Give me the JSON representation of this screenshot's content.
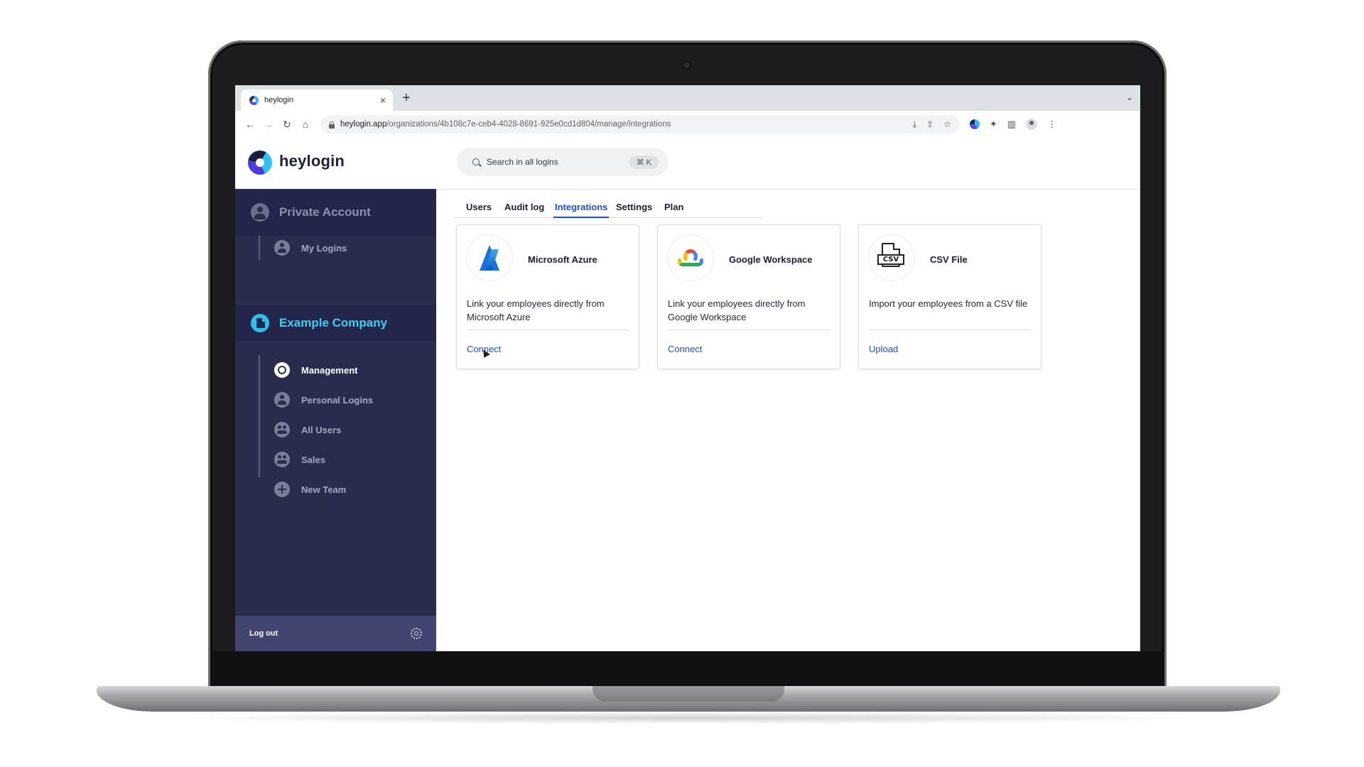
{
  "browser": {
    "tab_title": "heylogin",
    "tab_close": "×",
    "new_tab": "+",
    "tab_menu": "⌄",
    "url_host": "heylogin.app",
    "url_path": "/organizations/4b108c7e-ceb4-4028-8691-925e0cd1d804/manage/integrations",
    "back": "←",
    "forward": "→",
    "reload": "↻",
    "home": "⌂",
    "url_icons": [
      "⤓",
      "⇪",
      "☆"
    ],
    "extensions_icon": "✦",
    "sidepanel_icon": "▥",
    "menu_icon": "⋮"
  },
  "header": {
    "logo_text": "heylogin",
    "search_placeholder": "Search in all logins",
    "search_shortcut": "⌘ K"
  },
  "sidebar": {
    "private": {
      "label": "Private Account",
      "items": [
        {
          "label": "My Logins",
          "icon": "person-icon"
        }
      ]
    },
    "company": {
      "label": "Example Company",
      "items": [
        {
          "label": "Management",
          "icon": "gear-icon",
          "active": true
        },
        {
          "label": "Personal Logins",
          "icon": "person-icon"
        },
        {
          "label": "All Users",
          "icon": "group-icon"
        },
        {
          "label": "Sales",
          "icon": "group-icon"
        },
        {
          "label": "New Team",
          "icon": "plus-icon"
        }
      ]
    },
    "footer": {
      "logout": "Log out"
    }
  },
  "tabs": [
    {
      "label": "Users"
    },
    {
      "label": "Audit log"
    },
    {
      "label": "Integrations",
      "selected": true
    },
    {
      "label": "Settings"
    },
    {
      "label": "Plan"
    }
  ],
  "integrations": [
    {
      "title": "Microsoft Azure",
      "description": "Link your employees directly from Microsoft Azure",
      "action": "Connect",
      "icon": "azure-icon"
    },
    {
      "title": "Google Workspace",
      "description": "Link your employees directly from Google Workspace",
      "action": "Connect",
      "icon": "google-cloud-icon"
    },
    {
      "title": "CSV File",
      "description": "Import your employees from a CSV file",
      "action": "Upload",
      "icon": "csv-file-icon",
      "icon_text": "CSV"
    }
  ],
  "colors": {
    "sidebar_bg": "#2a2c4e",
    "accent_link": "#1c4fd6",
    "company_accent": "#3ccff5"
  }
}
